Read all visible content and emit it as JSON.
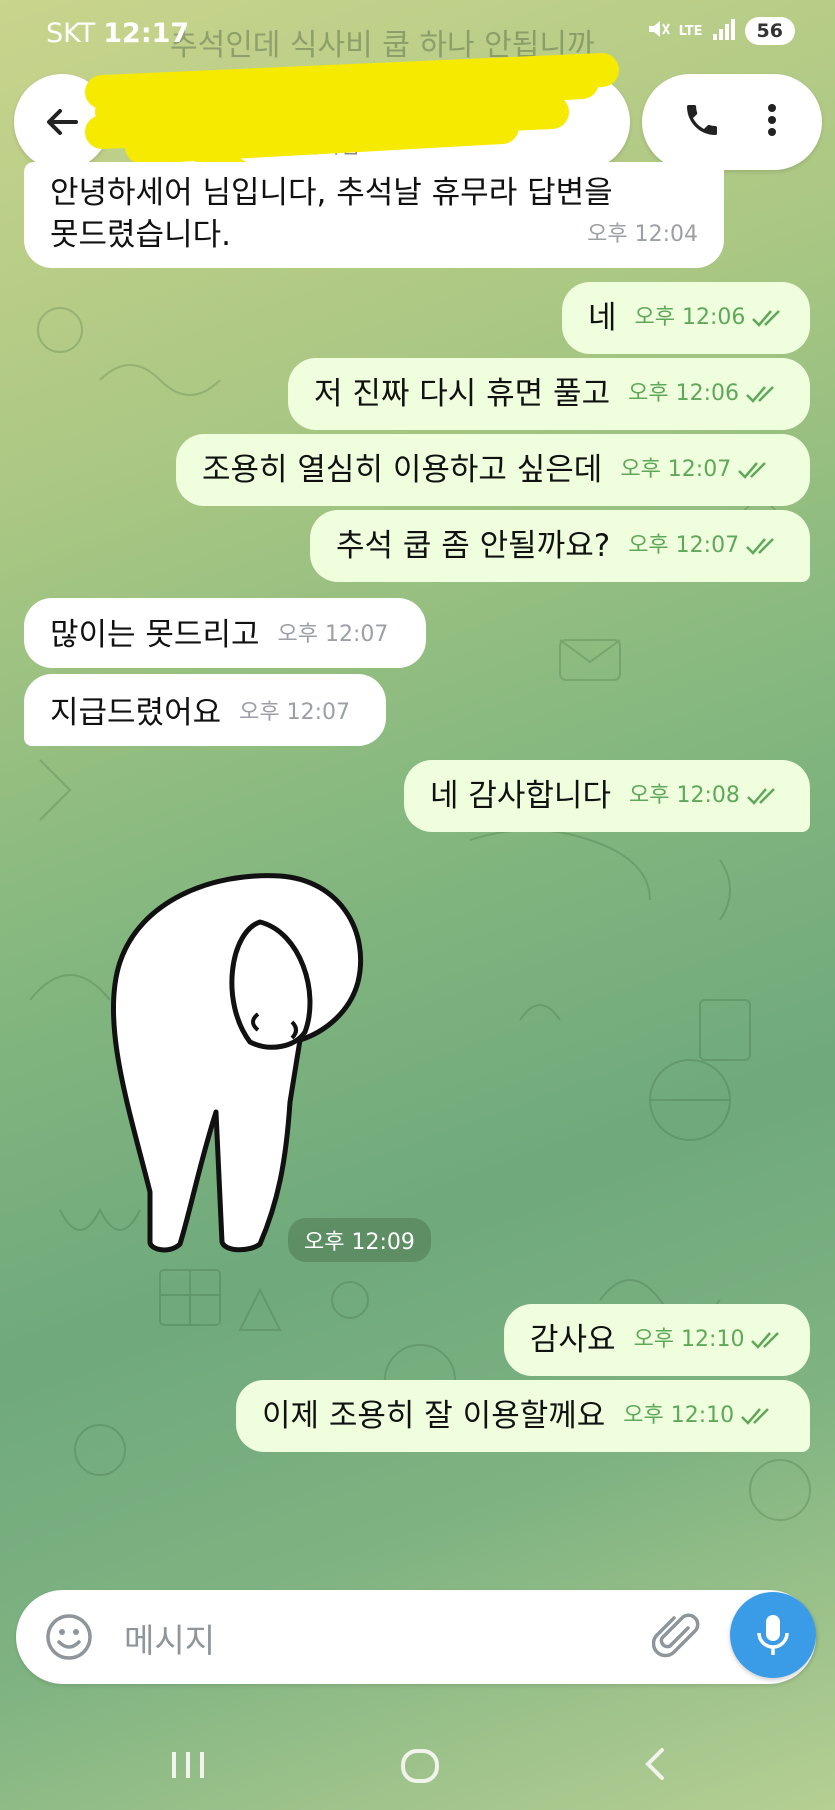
{
  "status_bar": {
    "carrier": "SKT",
    "time": "12:17",
    "notification": "추석인데 식사비 쿱 하나 안됩니까",
    "network": "LTE",
    "battery": "56"
  },
  "header": {
    "title": "",
    "subtitle": "접속함",
    "redacted": true
  },
  "messages": [
    {
      "dir": "in",
      "text": "안녕하세어 님입니다, 추석날 휴무라 답변을",
      "text2": "못드렸습니다.",
      "time": "오후 12:04"
    },
    {
      "dir": "out",
      "text": "네",
      "time": "오후 12:06"
    },
    {
      "dir": "out",
      "text": "저 진짜 다시 휴면 풀고",
      "time": "오후 12:06"
    },
    {
      "dir": "out",
      "text": "조용히 열심히 이용하고 싶은데",
      "time": "오후 12:07"
    },
    {
      "dir": "out",
      "text": "추석 쿱 좀 안될까요?",
      "time": "오후 12:07"
    },
    {
      "dir": "in",
      "text": "많이는 못드리고",
      "time": "오후 12:07"
    },
    {
      "dir": "in",
      "text": "지급드렸어요",
      "time": "오후 12:07"
    },
    {
      "dir": "out",
      "text": "네 감사합니다",
      "time": "오후 12:08"
    },
    {
      "dir": "sticker",
      "time": "오후 12:09"
    },
    {
      "dir": "out",
      "text": "감사요",
      "time": "오후 12:10"
    },
    {
      "dir": "out",
      "text": "이제 조용히 잘 이용할께요",
      "time": "오후 12:10"
    }
  ],
  "composer": {
    "placeholder": "메시지"
  },
  "colors": {
    "incoming": "#ffffff",
    "outgoing": "#effedd",
    "accent": "#3a9ce6",
    "read_check": "#5fa85a"
  },
  "icons": [
    "back-arrow-icon",
    "phone-icon",
    "more-vertical-icon",
    "emoji-icon",
    "paperclip-icon",
    "microphone-icon",
    "recent-apps-icon",
    "home-icon",
    "nav-back-icon"
  ]
}
